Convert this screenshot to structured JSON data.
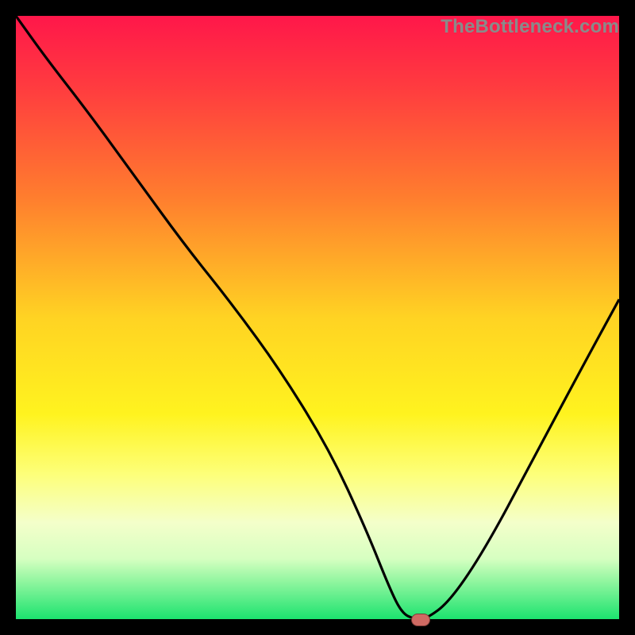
{
  "watermark": "TheBottleneck.com",
  "chart_data": {
    "type": "line",
    "title": "",
    "xlabel": "",
    "ylabel": "",
    "xlim": [
      0,
      100
    ],
    "ylim": [
      0,
      100
    ],
    "grid": false,
    "legend": false,
    "background": "red-yellow-green vertical gradient",
    "series": [
      {
        "name": "bottleneck-curve",
        "color": "#000000",
        "x": [
          0,
          5,
          12,
          20,
          28,
          36,
          44,
          52,
          58,
          62,
          64,
          66,
          68,
          72,
          78,
          86,
          94,
          100
        ],
        "y": [
          100,
          93,
          84,
          73,
          62,
          52,
          41,
          28,
          15,
          5,
          1,
          0,
          0,
          3,
          12,
          27,
          42,
          53
        ]
      }
    ],
    "marker": {
      "x": 67,
      "y": 0,
      "shape": "rounded-rect",
      "color": "#cf6a63"
    },
    "gradient_stops": [
      {
        "pct": 0,
        "color": "#ff174a"
      },
      {
        "pct": 12,
        "color": "#ff3c3f"
      },
      {
        "pct": 30,
        "color": "#ff7d2e"
      },
      {
        "pct": 50,
        "color": "#ffd323"
      },
      {
        "pct": 66,
        "color": "#fff31f"
      },
      {
        "pct": 76,
        "color": "#fdff7a"
      },
      {
        "pct": 84,
        "color": "#f4ffca"
      },
      {
        "pct": 90,
        "color": "#d6ffc1"
      },
      {
        "pct": 94,
        "color": "#8cf59d"
      },
      {
        "pct": 100,
        "color": "#1ce36f"
      }
    ]
  }
}
